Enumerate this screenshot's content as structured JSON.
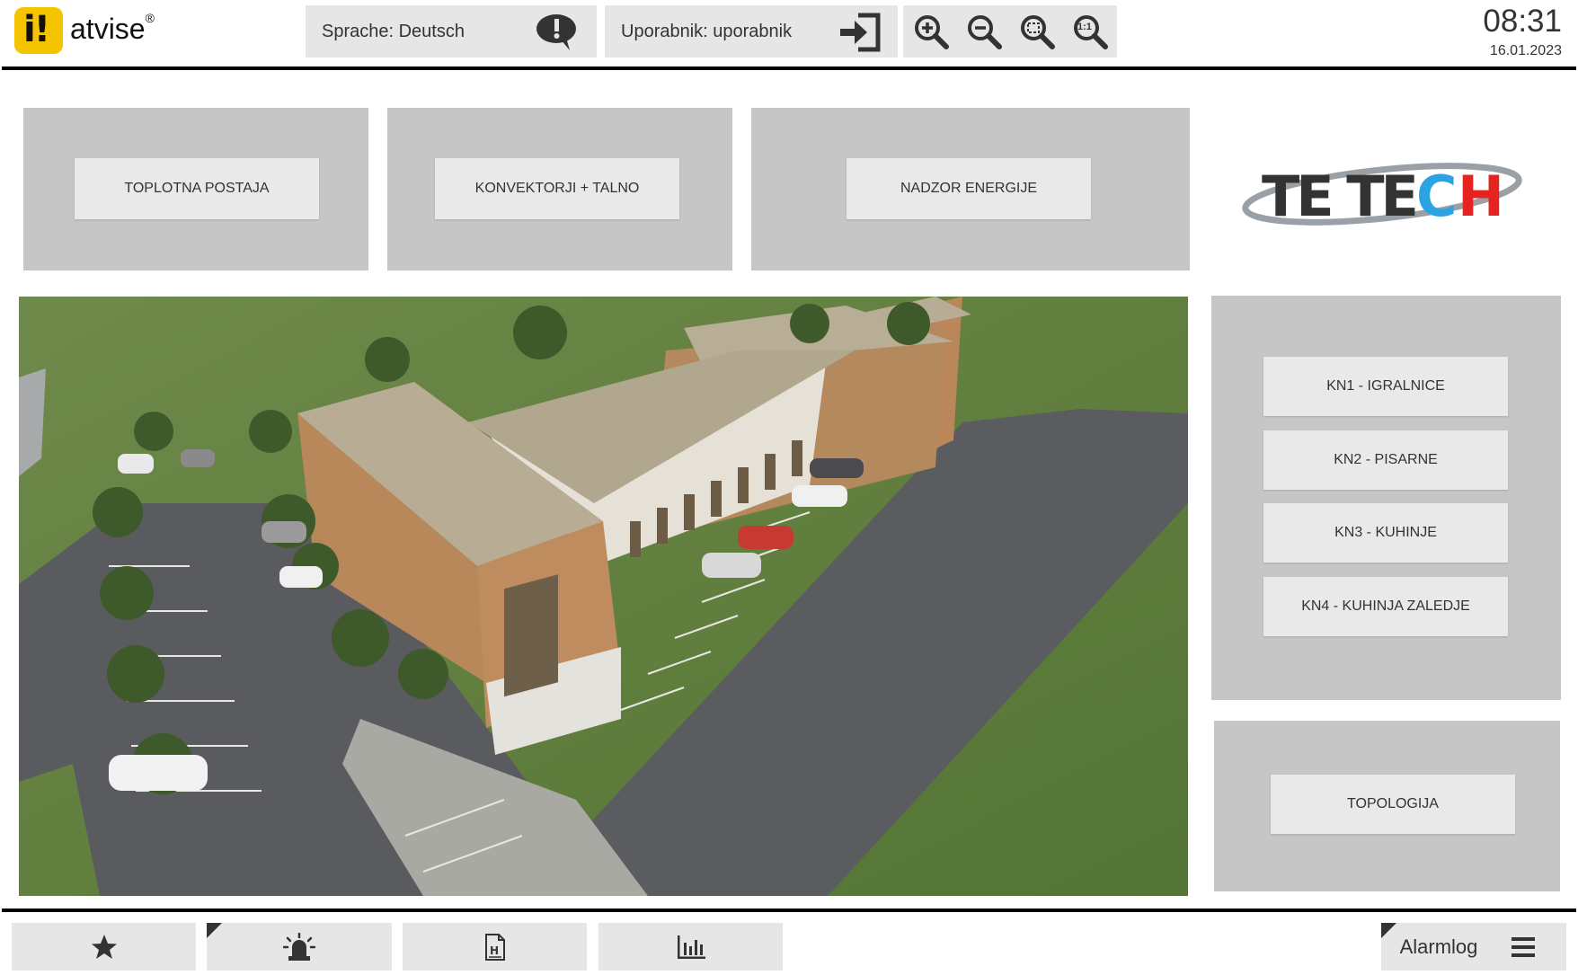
{
  "header": {
    "brand": "atvise",
    "language_label": "Sprache: Deutsch",
    "user_label": "Uporabnik: uporabnik",
    "zoom_reset_label": "1:1",
    "time": "08:31",
    "date": "16.01.2023"
  },
  "top_nav": [
    {
      "label": "TOPLOTNA POSTAJA"
    },
    {
      "label": "KONVEKTORJI + TALNO"
    },
    {
      "label": "NADZOR ENERGIJE"
    }
  ],
  "company_logo": {
    "text_dark": "TE TE",
    "text_c": "C",
    "text_h": "H",
    "colors": {
      "dark": "#333333",
      "blue": "#2aa3e0",
      "red": "#e52421",
      "ring": "#9aa0a6"
    }
  },
  "side_nav": [
    {
      "label": "KN1 - IGRALNICE"
    },
    {
      "label": "KN2 - PISARNE"
    },
    {
      "label": "KN3 - KUHINJE"
    },
    {
      "label": "KN4 - KUHINJA ZALEDJE"
    }
  ],
  "topology": {
    "label": "TOPOLOGIJA"
  },
  "footer": {
    "icons": [
      "star-icon",
      "alarm-siren-icon",
      "report-icon",
      "bar-chart-icon",
      "menu-icon"
    ],
    "alarmlog_label": "Alarmlog"
  },
  "colors": {
    "brand_yellow": "#f5c400",
    "panel_gray": "#c6c6c6",
    "button_gray": "#e9e9e9"
  }
}
